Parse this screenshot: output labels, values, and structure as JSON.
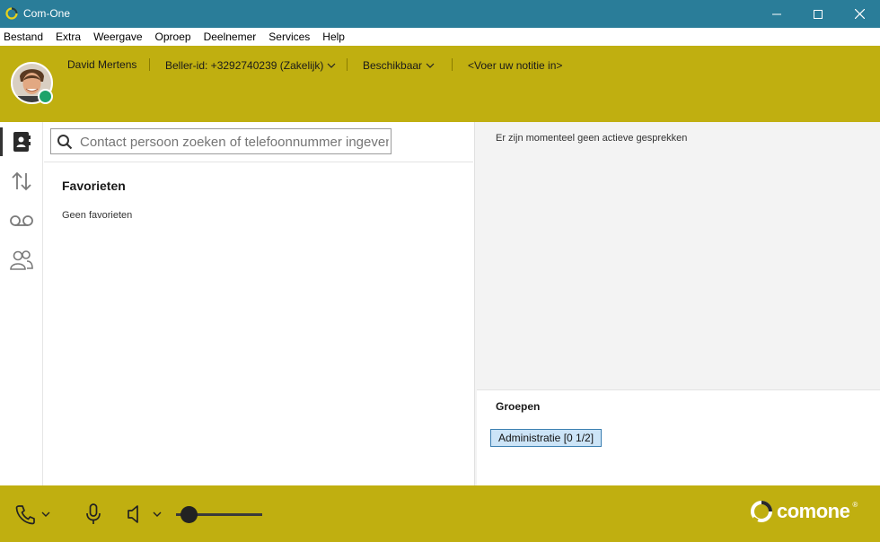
{
  "window": {
    "title": "Com-One",
    "app_icon": "comone-icon",
    "controls": [
      "minimize-icon",
      "maximize-icon",
      "close-icon"
    ]
  },
  "menu": [
    "Bestand",
    "Extra",
    "Weergave",
    "Oproep",
    "Deelnemer",
    "Services",
    "Help"
  ],
  "header": {
    "user_name": "David Mertens",
    "caller_id": "Beller-id: +3292740239 (Zakelijk)",
    "status": "Beschikbaar",
    "note_placeholder": "<Voer uw notitie in>",
    "presence_color": "#1ea36a",
    "band_color": "#c0af10"
  },
  "nav": [
    "contacts-icon",
    "call-history-icon",
    "voicemail-icon",
    "groups-icon"
  ],
  "search": {
    "placeholder": "Contact persoon zoeken of telefoonnummer ingeven"
  },
  "favorites": {
    "title": "Favorieten",
    "empty": "Geen favorieten"
  },
  "calls": {
    "empty": "Er zijn momenteel geen actieve gesprekken"
  },
  "groups": {
    "title": "Groepen",
    "items": [
      "Administratie [0 1/2]"
    ]
  },
  "footer": {
    "volume_level": 0.15,
    "logo_text": "comone",
    "logo_mark": "®"
  }
}
